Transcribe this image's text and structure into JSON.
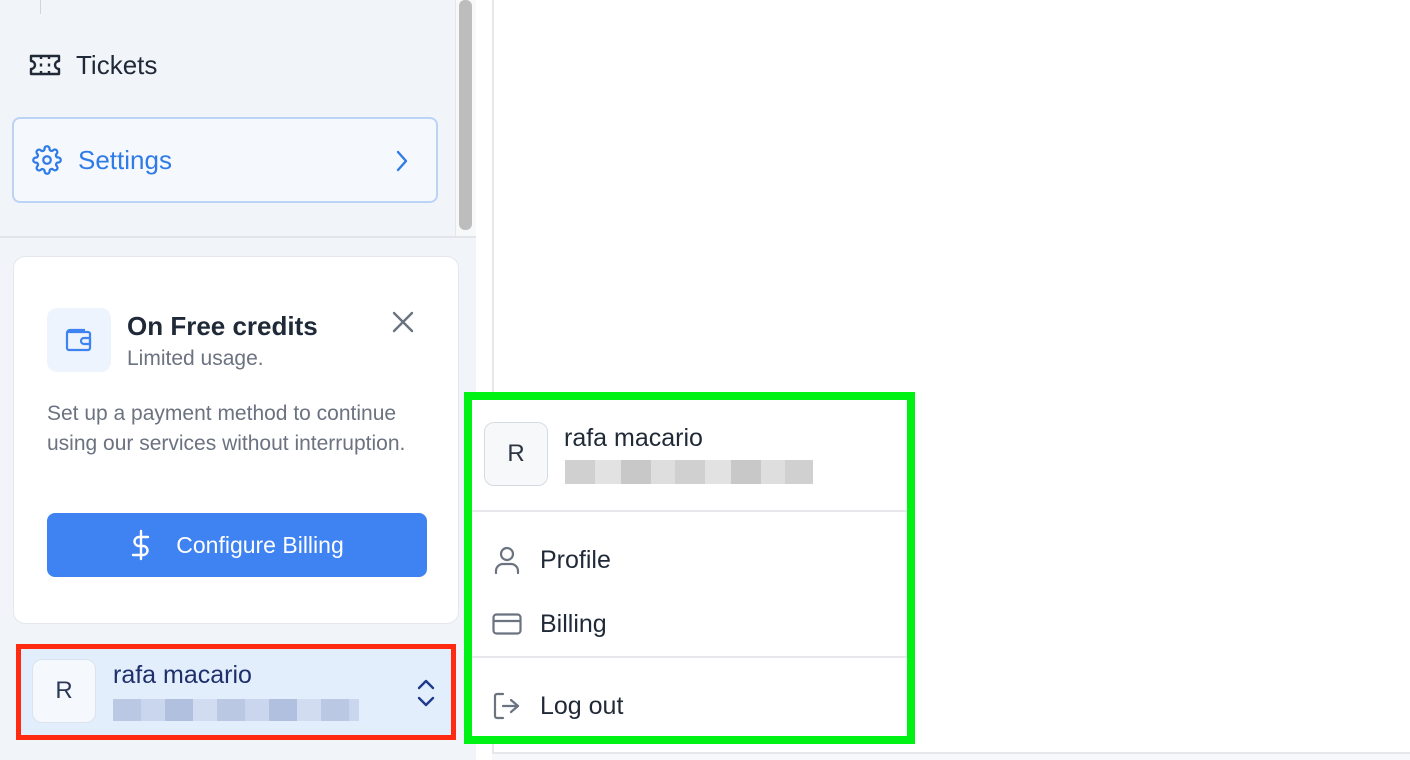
{
  "sidebar": {
    "nav": {
      "tickets": {
        "label": "Tickets",
        "icon": "ticket-icon"
      },
      "settings": {
        "label": "Settings",
        "icon": "gear-icon",
        "accent": "#2f7be8"
      }
    }
  },
  "credits_card": {
    "title": "On Free credits",
    "subtitle": "Limited usage.",
    "description": "Set up a payment method to continue using our services without interruption.",
    "button_label": "Configure Billing",
    "button_color": "#3f82f1"
  },
  "user": {
    "initial": "R",
    "name": "rafa macario"
  },
  "user_menu": {
    "initial": "R",
    "name": "rafa macario",
    "items": [
      {
        "label": "Profile",
        "icon": "user-icon"
      },
      {
        "label": "Billing",
        "icon": "credit-card-icon"
      },
      {
        "label": "Log out",
        "icon": "logout-icon"
      }
    ]
  },
  "highlights": {
    "trigger_color": "#ff2a10",
    "menu_color": "#00f215"
  }
}
